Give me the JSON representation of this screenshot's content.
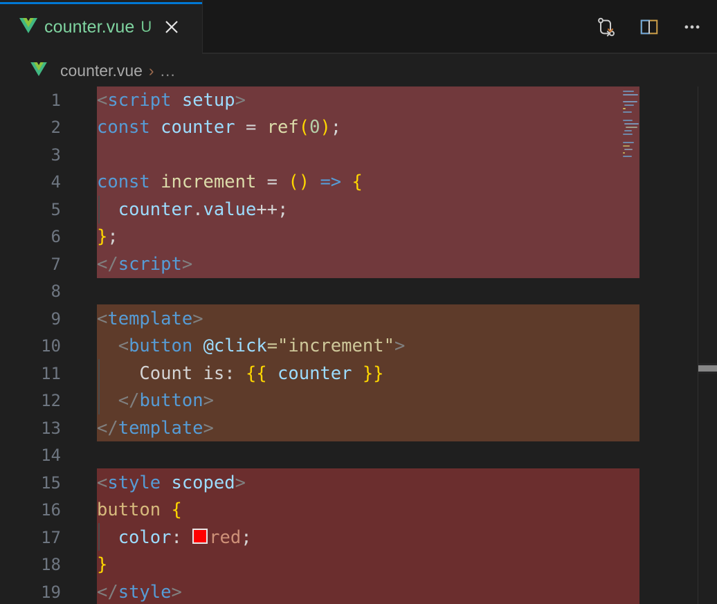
{
  "window": {
    "background": "#1f1f1f",
    "accent": "#0078d4"
  },
  "tab": {
    "label": "counter.vue",
    "badge": "U",
    "badge_title": "Untracked",
    "icon": "vue-file-icon",
    "close_icon": "close-icon",
    "active": true
  },
  "editor_actions": [
    {
      "name": "open-changes-icon",
      "label": "Open Changes"
    },
    {
      "name": "split-editor-icon",
      "label": "Split Editor Right"
    },
    {
      "name": "more-actions-icon",
      "label": "More Actions..."
    }
  ],
  "breadcrumb": {
    "file_icon": "vue-file-icon",
    "file": "counter.vue",
    "separator": "›",
    "more": "..."
  },
  "code": {
    "language": "vue",
    "line_numbers": [
      "1",
      "2",
      "3",
      "4",
      "5",
      "6",
      "7",
      "8",
      "9",
      "10",
      "11",
      "12",
      "13",
      "14",
      "15",
      "16",
      "17",
      "18",
      "19"
    ],
    "lines": [
      "<script setup>",
      "const counter = ref(0);",
      "",
      "const increment = () => {",
      "  counter.value++;",
      "};",
      "</script>",
      "",
      "<template>",
      "  <button @click=\"increment\">",
      "    Count is: {{ counter }}",
      "  </button>",
      "</template>",
      "",
      "<style scoped>",
      "button {",
      "  color: red;",
      "}",
      "</style>"
    ],
    "tokens": {
      "line1": {
        "a": "<",
        "b": "script",
        "c": " setup",
        "d": ">"
      },
      "line2": {
        "kw": "const",
        "var": "counter",
        "op": "=",
        "fn": "ref",
        "open": "(",
        "num": "0",
        "close": ")",
        "semi": ";"
      },
      "line4": {
        "kw": "const",
        "fn": "increment",
        "op": "=",
        "parens": "()",
        "arrow": "=>",
        "brace": "{"
      },
      "line5": {
        "var": "counter",
        "dot": ".",
        "prop": "value",
        "inc": "++",
        "semi": ";"
      },
      "line6": {
        "brace": "}",
        "semi": ";"
      },
      "line7": {
        "open": "</",
        "tag": "script",
        "close": ">"
      },
      "line9": {
        "open": "<",
        "tag": "template",
        "close": ">"
      },
      "line10": {
        "open": "<",
        "tag": "button",
        "attr": "@click",
        "eq": "=",
        "val": "\"increment\"",
        "close": ">"
      },
      "line11": {
        "text": "Count is: ",
        "mustache_open": "{{",
        "expr": " counter ",
        "mustache_close": "}}"
      },
      "line12": {
        "open": "</",
        "tag": "button",
        "close": ">"
      },
      "line13": {
        "open": "</",
        "tag": "template",
        "close": ">"
      },
      "line15": {
        "open": "<",
        "tag": "style",
        "attr": " scoped",
        "close": ">"
      },
      "line16": {
        "selector": "button",
        "brace": "{"
      },
      "line17": {
        "prop": "color",
        "colon": ":",
        "swatch_color": "#ff0000",
        "value": "red",
        "semi": ";"
      },
      "line18": {
        "brace": "}"
      },
      "line19": {
        "open": "</",
        "tag": "style",
        "close": ">"
      }
    },
    "region_colors": {
      "script": "#71393c",
      "template": "#5e3b2a",
      "style": "#6b2e2e"
    },
    "syntax_colors": {
      "keyword": "#569cd6",
      "variable": "#9cdcfe",
      "function": "#dcdcaa",
      "number": "#b5cea8",
      "string": "#ce9178",
      "punctuation": "#808080",
      "bracket": "#ffd700",
      "selector": "#d7ba7d",
      "text": "#d4d4d4",
      "linenumber": "#6e7681"
    }
  },
  "minimap": {
    "name": "minimap",
    "visible": true
  },
  "scrollbar": {
    "vertical": {
      "name": "vertical-scrollbar"
    },
    "horizontal": {
      "name": "horizontal-scrollbar"
    }
  }
}
